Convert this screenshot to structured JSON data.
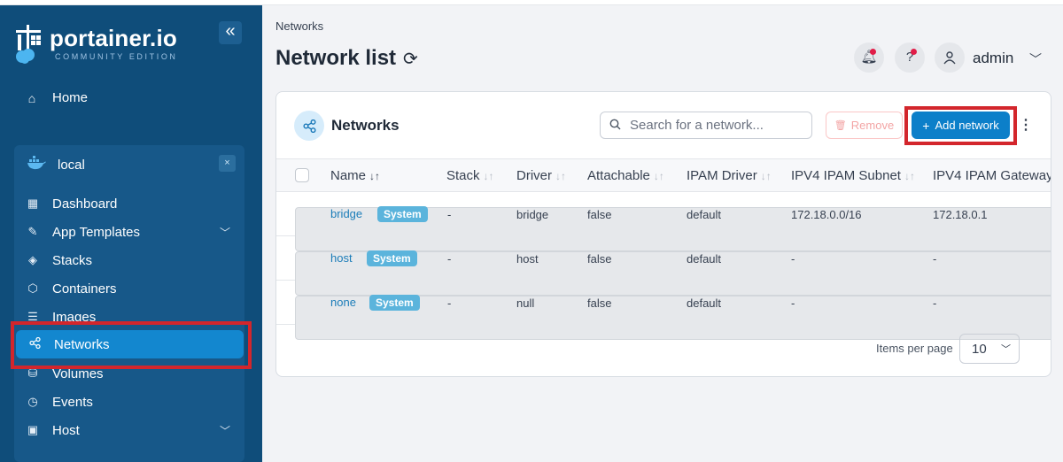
{
  "sidebar": {
    "logo": {
      "title": "portainer.io",
      "subtitle": "COMMUNITY EDITION"
    },
    "collapse_icon": "double-chevron-left-icon",
    "home_label": "Home",
    "environment": {
      "name": "local",
      "close_symbol": "×"
    },
    "items": [
      {
        "label": "Dashboard",
        "icon": "dashboard-icon"
      },
      {
        "label": "App Templates",
        "icon": "edit-icon"
      },
      {
        "label": "Stacks",
        "icon": "layers-icon"
      },
      {
        "label": "Containers",
        "icon": "box-icon"
      },
      {
        "label": "Images",
        "icon": "list-icon"
      },
      {
        "label": "Networks",
        "icon": "share-icon"
      },
      {
        "label": "Volumes",
        "icon": "database-icon"
      },
      {
        "label": "Events",
        "icon": "clock-icon"
      },
      {
        "label": "Host",
        "icon": "host-icon"
      }
    ]
  },
  "header": {
    "breadcrumb": "Networks",
    "title": "Network list",
    "user": "admin"
  },
  "card": {
    "title": "Networks",
    "search_placeholder": "Search for a network...",
    "remove_label": "Remove",
    "add_label": "Add network",
    "columns": [
      "Name",
      "Stack",
      "Driver",
      "Attachable",
      "IPAM Driver",
      "IPV4 IPAM Subnet",
      "IPV4 IPAM Gateway"
    ],
    "rows": [
      {
        "name": "bridge",
        "badge": "System",
        "stack": "-",
        "driver": "bridge",
        "attachable": "false",
        "ipam_driver": "default",
        "subnet": "172.18.0.0/16",
        "gateway": "172.18.0.1"
      },
      {
        "name": "host",
        "badge": "System",
        "stack": "-",
        "driver": "host",
        "attachable": "false",
        "ipam_driver": "default",
        "subnet": "-",
        "gateway": "-"
      },
      {
        "name": "none",
        "badge": "System",
        "stack": "-",
        "driver": "null",
        "attachable": "false",
        "ipam_driver": "default",
        "subnet": "-",
        "gateway": "-"
      }
    ],
    "items_per_page_label": "Items per page",
    "items_per_page_value": "10"
  },
  "colors": {
    "sidebar": "#0f4d7a",
    "accent": "#0c7fc9",
    "highlight": "#d3262c",
    "badge": "#5bb4dc"
  }
}
